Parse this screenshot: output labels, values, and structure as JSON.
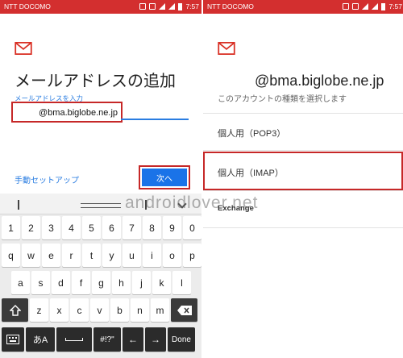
{
  "left": {
    "status": {
      "carrier": "NTT DOCOMO",
      "time": "7:57"
    },
    "title": "メールアドレスの追加",
    "field_label": "メールアドレスを入力",
    "email_value": "@bma.biglobe.ne.jp",
    "manual_setup": "手動セットアップ",
    "next": "次へ",
    "keyboard": {
      "row_numbers": [
        "1",
        "2",
        "3",
        "4",
        "5",
        "6",
        "7",
        "8",
        "9",
        "0"
      ],
      "row_q": [
        "q",
        "w",
        "e",
        "r",
        "t",
        "y",
        "u",
        "i",
        "o",
        "p"
      ],
      "row_a": [
        "a",
        "s",
        "d",
        "f",
        "g",
        "h",
        "j",
        "k",
        "l"
      ],
      "row_z": [
        "z",
        "x",
        "c",
        "v",
        "b",
        "n",
        "m"
      ],
      "bottom": {
        "mode": "あA",
        "symbols": "#!?\"",
        "done": "Done"
      }
    }
  },
  "right": {
    "status": {
      "carrier": "NTT DOCOMO",
      "time": "7:57"
    },
    "email": "@bma.biglobe.ne.jp",
    "subtitle": "このアカウントの種類を選択します",
    "options": [
      "個人用（POP3）",
      "個人用（IMAP）",
      "Exchange"
    ]
  },
  "watermark": "androidlover.net",
  "colors": {
    "accent": "#1a73e8",
    "highlight": "#c62828",
    "status": "#d32f2f"
  }
}
